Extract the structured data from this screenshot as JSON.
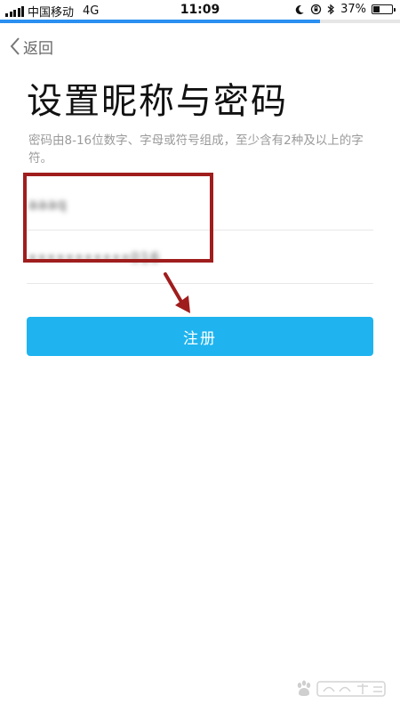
{
  "status_bar": {
    "carrier": "中国移动",
    "network": "4G",
    "time": "11:09",
    "battery": "37%",
    "battery_level": 0.37
  },
  "page_progress": 0.8,
  "nav": {
    "back_label": "返回"
  },
  "header": {
    "title": "设置昵称与密码",
    "description": "密码由8-16位数字、字母或符号组成，至少含有2种及以上的字符。"
  },
  "form": {
    "nickname_value": "aaaq",
    "password_value": "•••••••••••016"
  },
  "register_button": {
    "label": "注册"
  },
  "colors": {
    "accent": "#1fb4ef",
    "progress": "#2a8ff0",
    "annotation": "#a01d1d"
  }
}
